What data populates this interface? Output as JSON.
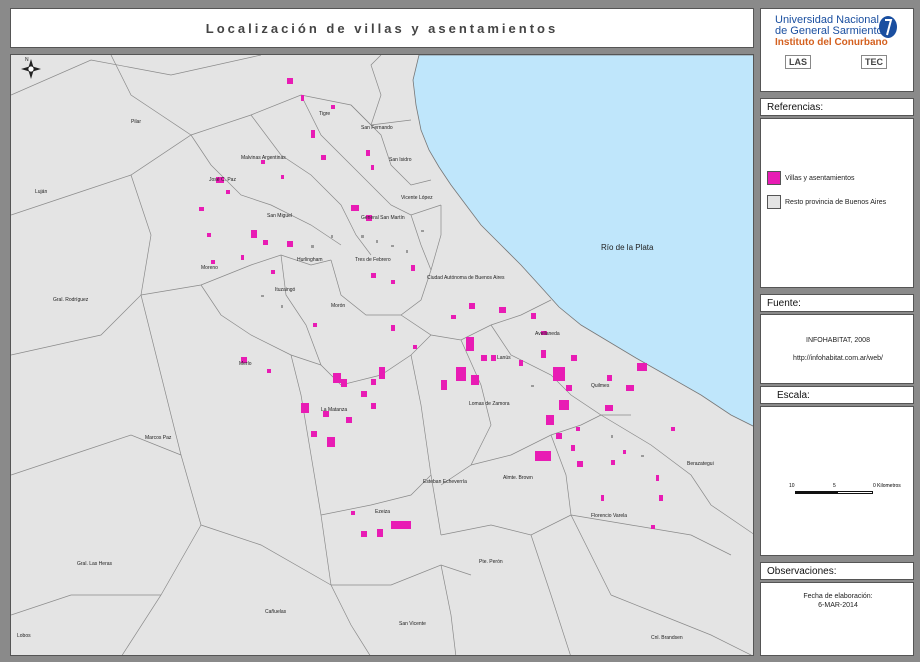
{
  "title": "Localización de villas y asentamientos",
  "logo": {
    "line1": "Universidad Nacional",
    "line2": "de General Sarmiento",
    "line3": "Instituto del Conurbano",
    "badge_left": "LAS",
    "badge_right": "TEC"
  },
  "legend": {
    "header": "Referencias:",
    "items": [
      {
        "label": "Villas y asentamientos",
        "color": "#e81cb4"
      },
      {
        "label": "Resto provincia de Buenos Aires",
        "color": "#e4e4e4"
      }
    ]
  },
  "source": {
    "header": "Fuente:",
    "line1": "INFOHABITAT, 2008",
    "line2": "http://infohabitat.com.ar/web/"
  },
  "scale": {
    "header": "Escala:",
    "ticks": [
      "10",
      "5",
      "0"
    ],
    "unit": "0 Kilometros"
  },
  "notes": {
    "header": "Observaciones:",
    "line1": "Fecha de elaboración:",
    "line2": "6-MAR-2014"
  },
  "map": {
    "water_label": "Río de la Plata",
    "north": "N",
    "colors": {
      "land": "#e4e4e4",
      "water": "#bfe6fb",
      "settlement": "#e81cb4",
      "border": "#777777"
    },
    "labels": {
      "pilar": "Pilar",
      "lujan": "Luján",
      "tigre": "Tigre",
      "san_fernando": "San Fernando",
      "san_isidro": "San Isidro",
      "malvinas": "Malvinas Argentinas",
      "jose_c_paz": "José C. Paz",
      "vicente_lopez": "Vicente López",
      "san_miguel": "San Miguel",
      "general_san_martin": "General San Martín",
      "hurlingham": "Hurlingham",
      "tres_de_febrero": "Tres de Febrero",
      "moreno": "Moreno",
      "caba": "Ciudad Autónoma de Buenos Aires",
      "ituzaingo": "Ituzaingó",
      "moron": "Morón",
      "gral_rodriguez": "Gral. Rodríguez",
      "avellaneda": "Avellaneda",
      "lanus": "Lanús",
      "merlo": "Merlo",
      "quilmes": "Quilmes",
      "la_matanza": "La Matanza",
      "lomas": "Lomas de Zamora",
      "marcos_paz": "Marcos Paz",
      "berazategui": "Berazategui",
      "alte_brown": "Almte. Brown",
      "esteban_echeverria": "Esteban Echeverría",
      "ezeiza": "Ezeiza",
      "florencio_varela": "Florencio Varela",
      "gral_las_heras": "Gral. Las Heras",
      "pte_peron": "Pte. Perón",
      "canuelas": "Cañuelas",
      "san_vicente": "San Vicente",
      "lobos": "Lobos",
      "brandsen": "Cnl. Brandsen"
    }
  }
}
